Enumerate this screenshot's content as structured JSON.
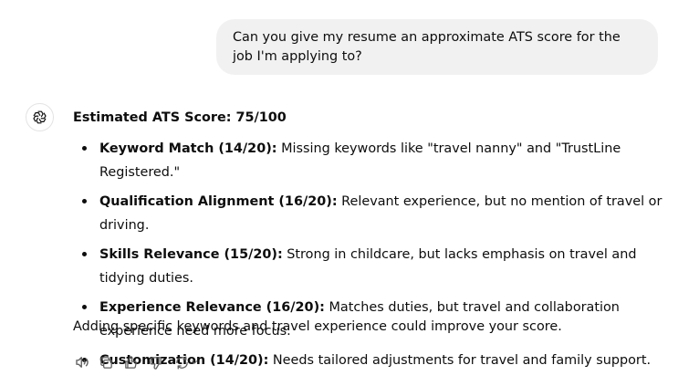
{
  "user_message": {
    "text": "Can you give my resume an approximate ATS score for the job I'm applying to?"
  },
  "assistant": {
    "avatar_icon": "openai-logo-icon",
    "title": "Estimated ATS Score: 75/100",
    "items": [
      {
        "heading": "Keyword Match (14/20):",
        "text": " Missing keywords like \"travel nanny\" and \"TrustLine Registered.\""
      },
      {
        "heading": "Qualification Alignment (16/20):",
        "text": " Relevant experience, but no mention of travel or driving."
      },
      {
        "heading": "Skills Relevance (15/20):",
        "text": " Strong in childcare, but lacks emphasis on travel and tidying duties."
      },
      {
        "heading": "Experience Relevance (16/20):",
        "text": " Matches duties, but travel and collaboration experience need more focus."
      },
      {
        "heading": "Customization (14/20):",
        "text": " Needs tailored adjustments for travel and family support."
      }
    ],
    "closing": "Adding specific keywords and travel experience could improve your score."
  },
  "actions": [
    {
      "icon": "speaker-icon"
    },
    {
      "icon": "copy-icon"
    },
    {
      "icon": "thumbs-up-icon"
    },
    {
      "icon": "thumbs-down-icon"
    },
    {
      "icon": "regenerate-icon"
    }
  ],
  "colors": {
    "text": "#0d0d0d",
    "bubble_bg": "#f1f1f1",
    "icon": "#5d5d5d"
  }
}
